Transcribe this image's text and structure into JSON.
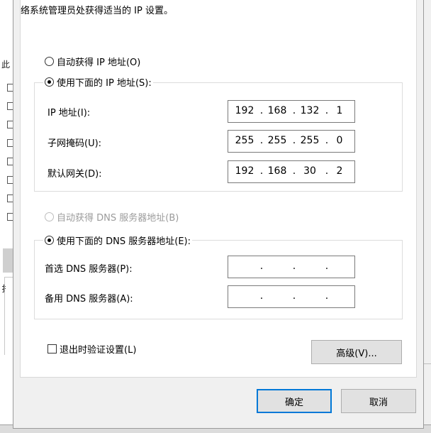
{
  "intro_text": "络系统管理员处获得适当的 IP 设置。",
  "background": {
    "left_fragment": "此",
    "left_fragment2": "扌"
  },
  "ip_mode": {
    "auto_label": "自动获得 IP 地址(O)",
    "manual_label": "使用下面的 IP 地址(S):",
    "selected": "manual"
  },
  "ip_fields": [
    {
      "label": "IP 地址(I):",
      "octets": [
        "192",
        "168",
        "132",
        "1"
      ]
    },
    {
      "label": "子网掩码(U):",
      "octets": [
        "255",
        "255",
        "255",
        "0"
      ]
    },
    {
      "label": "默认网关(D):",
      "octets": [
        "192",
        "168",
        "30",
        "2"
      ]
    }
  ],
  "dns_mode": {
    "auto_label": "自动获得 DNS 服务器地址(B)",
    "manual_label": "使用下面的 DNS 服务器地址(E):",
    "selected": "manual"
  },
  "dns_fields": [
    {
      "label": "首选 DNS 服务器(P):",
      "octets": [
        "",
        "",
        "",
        ""
      ]
    },
    {
      "label": "备用 DNS 服务器(A):",
      "octets": [
        "",
        "",
        "",
        ""
      ]
    }
  ],
  "validate_label": "退出时验证设置(L)",
  "advanced_label": "高级(V)...",
  "ok_label": "确定",
  "cancel_label": "取消"
}
